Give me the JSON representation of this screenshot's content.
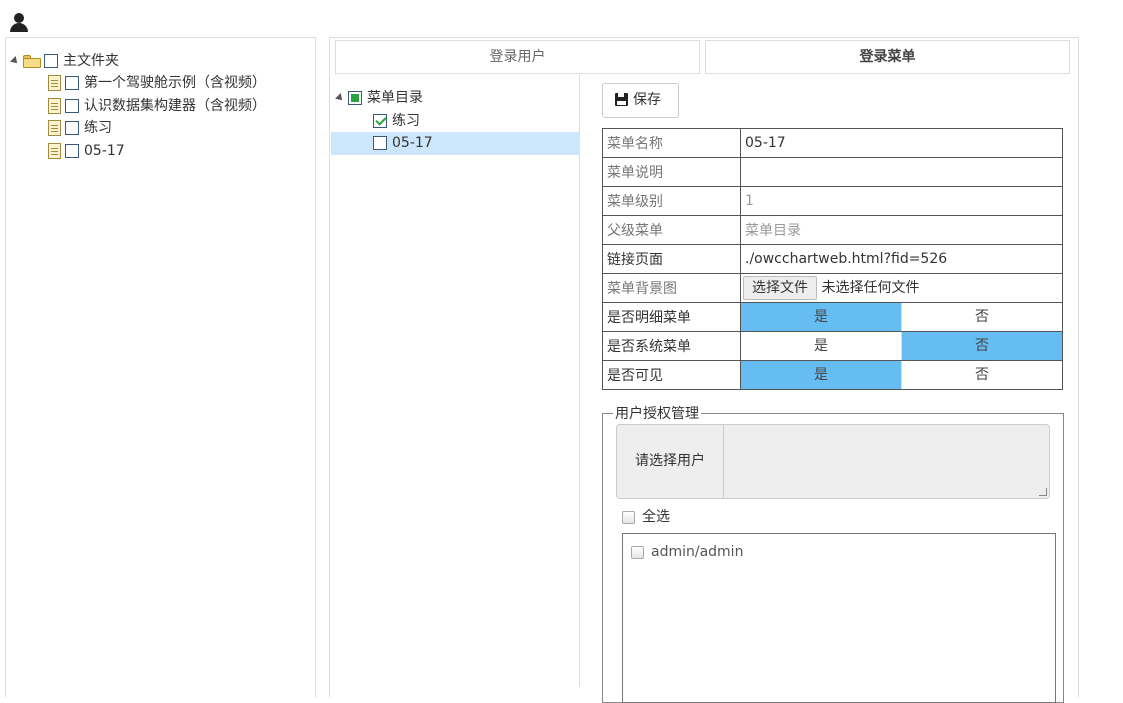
{
  "left_tree": {
    "root": "主文件夹",
    "children": [
      "第一个驾驶舱示例（含视频）",
      "认识数据集构建器（含视频）",
      "练习",
      "05-17"
    ]
  },
  "tabs": [
    "登录用户",
    "登录菜单"
  ],
  "menu_tree": {
    "root": "菜单目录",
    "children": [
      {
        "label": "练习",
        "checked": true
      },
      {
        "label": "05-17",
        "checked": false
      }
    ]
  },
  "save_label": "保存",
  "form": {
    "menu_name_label": "菜单名称",
    "menu_name_value": "05-17",
    "menu_desc_label": "菜单说明",
    "menu_desc_value": "",
    "menu_level_label": "菜单级别",
    "menu_level_value": "1",
    "parent_label": "父级菜单",
    "parent_value": "菜单目录",
    "link_label": "链接页面",
    "link_value": "./owcchartweb.html?fid=526",
    "bg_label": "菜单背景图",
    "file_button": "选择文件",
    "file_status": "未选择任何文件",
    "detail_label": "是否明细菜单",
    "system_label": "是否系统菜单",
    "visible_label": "是否可见",
    "yes": "是",
    "no": "否",
    "detail_selected": "是",
    "system_selected": "否",
    "visible_selected": "是"
  },
  "auth": {
    "legend": "用户授权管理",
    "select_user_label": "请选择用户",
    "select_all_label": "全选",
    "users": [
      "admin/admin"
    ]
  },
  "colors": {
    "selected_toggle": "#66bdf2",
    "selected_row": "#cde6fb"
  }
}
